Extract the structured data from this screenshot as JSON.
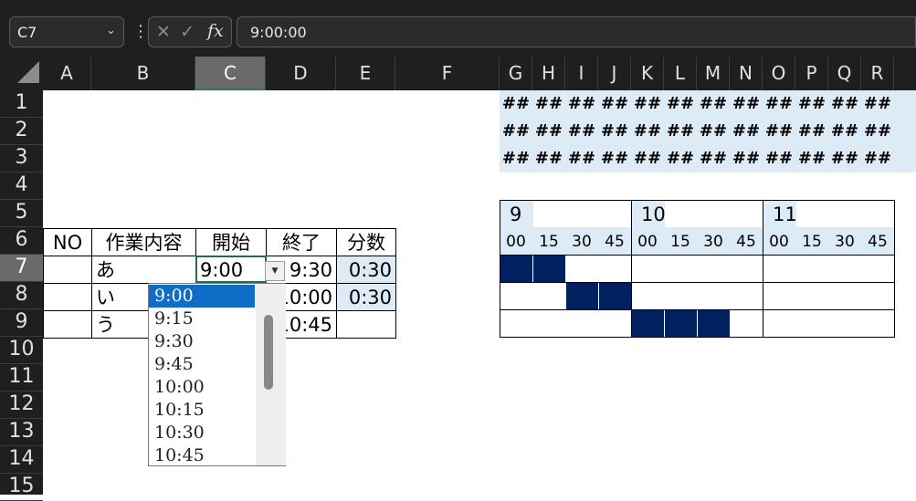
{
  "formula_bar": {
    "name_box": "C7",
    "cancel_symbol": "✕",
    "enter_symbol": "✓",
    "fx_symbol": "fx",
    "formula": "9:00:00"
  },
  "columns": [
    "A",
    "B",
    "C",
    "D",
    "E",
    "F",
    "G",
    "H",
    "I",
    "J",
    "K",
    "L",
    "M",
    "N",
    "O",
    "P",
    "Q",
    "R"
  ],
  "rows": [
    "1",
    "2",
    "3",
    "4",
    "5",
    "6",
    "7",
    "8",
    "9",
    "10",
    "11",
    "12",
    "13",
    "14",
    "15"
  ],
  "hash_placeholder": "##",
  "table": {
    "headers": [
      "NO",
      "作業内容",
      "開始",
      "終了",
      "分数"
    ],
    "rows": [
      {
        "task": "あ",
        "start": "9:00",
        "end": "9:30",
        "minutes": "0:30"
      },
      {
        "task": "い",
        "start": "",
        "end": "10:00",
        "minutes": "0:30"
      },
      {
        "task": "う",
        "start": "",
        "end": "10:45",
        "minutes": ""
      }
    ]
  },
  "gantt": {
    "hours": [
      "9",
      "10",
      "11"
    ],
    "quarters": [
      "00",
      "15",
      "30",
      "45"
    ],
    "filled": [
      [
        0,
        1
      ],
      [
        2,
        3
      ],
      [
        4,
        5,
        6
      ]
    ],
    "fill_color": "#002060"
  },
  "dropdown": {
    "options": [
      "9:00",
      "9:15",
      "9:30",
      "9:45",
      "10:00",
      "10:15",
      "10:30",
      "10:45"
    ],
    "selected_index": 0
  }
}
